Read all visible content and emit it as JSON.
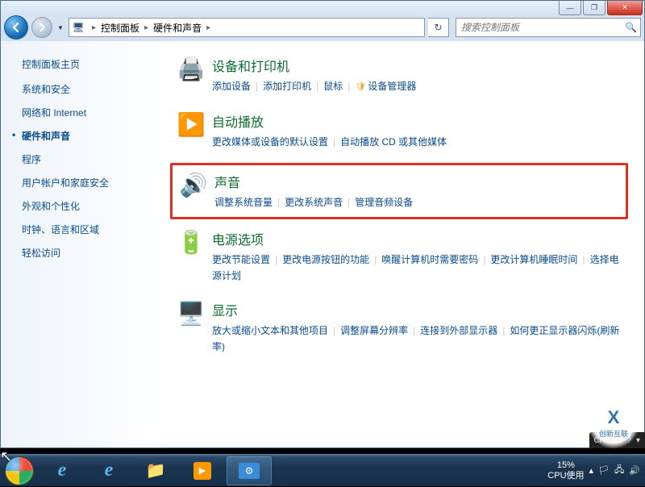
{
  "window": {
    "min": "—",
    "max": "❐",
    "close": "✕"
  },
  "breadcrumb": {
    "root": "控制面板",
    "current": "硬件和声音"
  },
  "search": {
    "placeholder": "搜索控制面板"
  },
  "sidebar": {
    "title": "控制面板主页",
    "items": [
      {
        "label": "系统和安全"
      },
      {
        "label": "网络和 Internet"
      },
      {
        "label": "硬件和声音",
        "active": true
      },
      {
        "label": "程序"
      },
      {
        "label": "用户帐户和家庭安全"
      },
      {
        "label": "外观和个性化"
      },
      {
        "label": "时钟、语言和区域"
      },
      {
        "label": "轻松访问"
      }
    ]
  },
  "categories": [
    {
      "title": "设备和打印机",
      "icon": "🖨️",
      "links": [
        {
          "text": "添加设备"
        },
        {
          "text": "添加打印机"
        },
        {
          "text": "鼠标"
        },
        {
          "text": "设备管理器",
          "shield": true
        }
      ]
    },
    {
      "title": "自动播放",
      "icon": "▶️",
      "links": [
        {
          "text": "更改媒体或设备的默认设置"
        },
        {
          "text": "自动播放 CD 或其他媒体"
        }
      ]
    },
    {
      "title": "声音",
      "icon": "🔊",
      "highlight": true,
      "links": [
        {
          "text": "调整系统音量"
        },
        {
          "text": "更改系统声音"
        },
        {
          "text": "管理音频设备"
        }
      ]
    },
    {
      "title": "电源选项",
      "icon": "🔋",
      "links": [
        {
          "text": "更改节能设置"
        },
        {
          "text": "更改电源按钮的功能"
        },
        {
          "text": "唤醒计算机时需要密码"
        },
        {
          "text": "更改计算机睡眠时间"
        },
        {
          "text": "选择电源计划"
        }
      ]
    },
    {
      "title": "显示",
      "icon": "🖥️",
      "links": [
        {
          "text": "放大或缩小文本和其他项目"
        },
        {
          "text": "调整屏幕分辨率"
        },
        {
          "text": "连接到外部显示器"
        },
        {
          "text": "如何更正显示器闪烁(刷新率)"
        }
      ]
    }
  ],
  "taskbar": {
    "items": [
      {
        "name": "ie-icon",
        "glyph": "e"
      },
      {
        "name": "ie-alt-icon",
        "glyph": "e"
      },
      {
        "name": "explorer-icon",
        "glyph": "📁"
      },
      {
        "name": "media-player-icon",
        "glyph": "▶"
      },
      {
        "name": "control-panel-icon",
        "glyph": "⚙",
        "active": true
      }
    ],
    "cpu_pct": "15%",
    "cpu_label": "CPU使用"
  },
  "langbar": {
    "ch": "CH",
    "keyboard": "⌨",
    "help": "?"
  },
  "watermark": {
    "logo": "X",
    "text1": "创新互联",
    "text2": "CHUANG XINHULIAN"
  }
}
